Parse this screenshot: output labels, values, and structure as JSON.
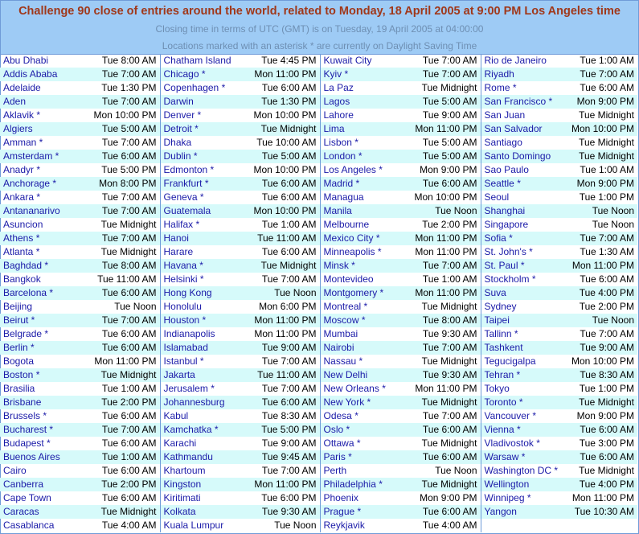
{
  "header": {
    "title": "Challenge 90 close of entries around the world, related to Monday, 18 April 2005 at 9:00 PM Los Angeles time",
    "utc_line": "Closing time in terms of UTC (GMT) is on Tuesday, 19 April 2005 at 04:00:00",
    "dst_line": "Locations marked with an asterisk * are currently on Daylight Saving Time"
  },
  "colors": {
    "header_bg": "#9ecbf5",
    "title_text": "#a0381a",
    "subtitle_text": "#6e8fb3",
    "city_link": "#1a1aa8",
    "row_stripe": "#d6fafa",
    "border": "#6f9bd8"
  },
  "rows": [
    [
      [
        "Abu Dhabi",
        "Tue 8:00 AM"
      ],
      [
        "Chatham Island",
        "Tue 4:45 PM"
      ],
      [
        "Kuwait City",
        "Tue 7:00 AM"
      ],
      [
        "Rio de Janeiro",
        "Tue 1:00 AM"
      ]
    ],
    [
      [
        "Addis Ababa",
        "Tue 7:00 AM"
      ],
      [
        "Chicago *",
        "Mon 11:00 PM"
      ],
      [
        "Kyiv *",
        "Tue 7:00 AM"
      ],
      [
        "Riyadh",
        "Tue 7:00 AM"
      ]
    ],
    [
      [
        "Adelaide",
        "Tue 1:30 PM"
      ],
      [
        "Copenhagen *",
        "Tue 6:00 AM"
      ],
      [
        "La Paz",
        "Tue Midnight"
      ],
      [
        "Rome *",
        "Tue 6:00 AM"
      ]
    ],
    [
      [
        "Aden",
        "Tue 7:00 AM"
      ],
      [
        "Darwin",
        "Tue 1:30 PM"
      ],
      [
        "Lagos",
        "Tue 5:00 AM"
      ],
      [
        "San Francisco *",
        "Mon 9:00 PM"
      ]
    ],
    [
      [
        "Aklavik *",
        "Mon 10:00 PM"
      ],
      [
        "Denver *",
        "Mon 10:00 PM"
      ],
      [
        "Lahore",
        "Tue 9:00 AM"
      ],
      [
        "San Juan",
        "Tue Midnight"
      ]
    ],
    [
      [
        "Algiers",
        "Tue 5:00 AM"
      ],
      [
        "Detroit *",
        "Tue Midnight"
      ],
      [
        "Lima",
        "Mon 11:00 PM"
      ],
      [
        "San Salvador",
        "Mon 10:00 PM"
      ]
    ],
    [
      [
        "Amman *",
        "Tue 7:00 AM"
      ],
      [
        "Dhaka",
        "Tue 10:00 AM"
      ],
      [
        "Lisbon *",
        "Tue 5:00 AM"
      ],
      [
        "Santiago",
        "Tue Midnight"
      ]
    ],
    [
      [
        "Amsterdam *",
        "Tue 6:00 AM"
      ],
      [
        "Dublin *",
        "Tue 5:00 AM"
      ],
      [
        "London *",
        "Tue 5:00 AM"
      ],
      [
        "Santo Domingo",
        "Tue Midnight"
      ]
    ],
    [
      [
        "Anadyr *",
        "Tue 5:00 PM"
      ],
      [
        "Edmonton *",
        "Mon 10:00 PM"
      ],
      [
        "Los Angeles *",
        "Mon 9:00 PM"
      ],
      [
        "Sao Paulo",
        "Tue 1:00 AM"
      ]
    ],
    [
      [
        "Anchorage *",
        "Mon 8:00 PM"
      ],
      [
        "Frankfurt *",
        "Tue 6:00 AM"
      ],
      [
        "Madrid *",
        "Tue 6:00 AM"
      ],
      [
        "Seattle *",
        "Mon 9:00 PM"
      ]
    ],
    [
      [
        "Ankara *",
        "Tue 7:00 AM"
      ],
      [
        "Geneva *",
        "Tue 6:00 AM"
      ],
      [
        "Managua",
        "Mon 10:00 PM"
      ],
      [
        "Seoul",
        "Tue 1:00 PM"
      ]
    ],
    [
      [
        "Antananarivo",
        "Tue 7:00 AM"
      ],
      [
        "Guatemala",
        "Mon 10:00 PM"
      ],
      [
        "Manila",
        "Tue Noon"
      ],
      [
        "Shanghai",
        "Tue Noon"
      ]
    ],
    [
      [
        "Asuncion",
        "Tue Midnight"
      ],
      [
        "Halifax *",
        "Tue 1:00 AM"
      ],
      [
        "Melbourne",
        "Tue 2:00 PM"
      ],
      [
        "Singapore",
        "Tue Noon"
      ]
    ],
    [
      [
        "Athens *",
        "Tue 7:00 AM"
      ],
      [
        "Hanoi",
        "Tue 11:00 AM"
      ],
      [
        "Mexico City *",
        "Mon 11:00 PM"
      ],
      [
        "Sofia *",
        "Tue 7:00 AM"
      ]
    ],
    [
      [
        "Atlanta *",
        "Tue Midnight"
      ],
      [
        "Harare",
        "Tue 6:00 AM"
      ],
      [
        "Minneapolis *",
        "Mon 11:00 PM"
      ],
      [
        "St. John's *",
        "Tue 1:30 AM"
      ]
    ],
    [
      [
        "Baghdad *",
        "Tue 8:00 AM"
      ],
      [
        "Havana *",
        "Tue Midnight"
      ],
      [
        "Minsk *",
        "Tue 7:00 AM"
      ],
      [
        "St. Paul *",
        "Mon 11:00 PM"
      ]
    ],
    [
      [
        "Bangkok",
        "Tue 11:00 AM"
      ],
      [
        "Helsinki *",
        "Tue 7:00 AM"
      ],
      [
        "Montevideo",
        "Tue 1:00 AM"
      ],
      [
        "Stockholm *",
        "Tue 6:00 AM"
      ]
    ],
    [
      [
        "Barcelona *",
        "Tue 6:00 AM"
      ],
      [
        "Hong Kong",
        "Tue Noon"
      ],
      [
        "Montgomery *",
        "Mon 11:00 PM"
      ],
      [
        "Suva",
        "Tue 4:00 PM"
      ]
    ],
    [
      [
        "Beijing",
        "Tue Noon"
      ],
      [
        "Honolulu",
        "Mon 6:00 PM"
      ],
      [
        "Montreal *",
        "Tue Midnight"
      ],
      [
        "Sydney",
        "Tue 2:00 PM"
      ]
    ],
    [
      [
        "Beirut *",
        "Tue 7:00 AM"
      ],
      [
        "Houston *",
        "Mon 11:00 PM"
      ],
      [
        "Moscow *",
        "Tue 8:00 AM"
      ],
      [
        "Taipei",
        "Tue Noon"
      ]
    ],
    [
      [
        "Belgrade *",
        "Tue 6:00 AM"
      ],
      [
        "Indianapolis",
        "Mon 11:00 PM"
      ],
      [
        "Mumbai",
        "Tue 9:30 AM"
      ],
      [
        "Tallinn *",
        "Tue 7:00 AM"
      ]
    ],
    [
      [
        "Berlin *",
        "Tue 6:00 AM"
      ],
      [
        "Islamabad",
        "Tue 9:00 AM"
      ],
      [
        "Nairobi",
        "Tue 7:00 AM"
      ],
      [
        "Tashkent",
        "Tue 9:00 AM"
      ]
    ],
    [
      [
        "Bogota",
        "Mon 11:00 PM"
      ],
      [
        "Istanbul *",
        "Tue 7:00 AM"
      ],
      [
        "Nassau *",
        "Tue Midnight"
      ],
      [
        "Tegucigalpa",
        "Mon 10:00 PM"
      ]
    ],
    [
      [
        "Boston *",
        "Tue Midnight"
      ],
      [
        "Jakarta",
        "Tue 11:00 AM"
      ],
      [
        "New Delhi",
        "Tue 9:30 AM"
      ],
      [
        "Tehran *",
        "Tue 8:30 AM"
      ]
    ],
    [
      [
        "Brasilia",
        "Tue 1:00 AM"
      ],
      [
        "Jerusalem *",
        "Tue 7:00 AM"
      ],
      [
        "New Orleans *",
        "Mon 11:00 PM"
      ],
      [
        "Tokyo",
        "Tue 1:00 PM"
      ]
    ],
    [
      [
        "Brisbane",
        "Tue 2:00 PM"
      ],
      [
        "Johannesburg",
        "Tue 6:00 AM"
      ],
      [
        "New York *",
        "Tue Midnight"
      ],
      [
        "Toronto *",
        "Tue Midnight"
      ]
    ],
    [
      [
        "Brussels *",
        "Tue 6:00 AM"
      ],
      [
        "Kabul",
        "Tue 8:30 AM"
      ],
      [
        "Odesa *",
        "Tue 7:00 AM"
      ],
      [
        "Vancouver *",
        "Mon 9:00 PM"
      ]
    ],
    [
      [
        "Bucharest *",
        "Tue 7:00 AM"
      ],
      [
        "Kamchatka *",
        "Tue 5:00 PM"
      ],
      [
        "Oslo *",
        "Tue 6:00 AM"
      ],
      [
        "Vienna *",
        "Tue 6:00 AM"
      ]
    ],
    [
      [
        "Budapest *",
        "Tue 6:00 AM"
      ],
      [
        "Karachi",
        "Tue 9:00 AM"
      ],
      [
        "Ottawa *",
        "Tue Midnight"
      ],
      [
        "Vladivostok *",
        "Tue 3:00 PM"
      ]
    ],
    [
      [
        "Buenos Aires",
        "Tue 1:00 AM"
      ],
      [
        "Kathmandu",
        "Tue 9:45 AM"
      ],
      [
        "Paris *",
        "Tue 6:00 AM"
      ],
      [
        "Warsaw *",
        "Tue 6:00 AM"
      ]
    ],
    [
      [
        "Cairo",
        "Tue 6:00 AM"
      ],
      [
        "Khartoum",
        "Tue 7:00 AM"
      ],
      [
        "Perth",
        "Tue Noon"
      ],
      [
        "Washington DC *",
        "Tue Midnight"
      ]
    ],
    [
      [
        "Canberra",
        "Tue 2:00 PM"
      ],
      [
        "Kingston",
        "Mon 11:00 PM"
      ],
      [
        "Philadelphia *",
        "Tue Midnight"
      ],
      [
        "Wellington",
        "Tue 4:00 PM"
      ]
    ],
    [
      [
        "Cape Town",
        "Tue 6:00 AM"
      ],
      [
        "Kiritimati",
        "Tue 6:00 PM"
      ],
      [
        "Phoenix",
        "Mon 9:00 PM"
      ],
      [
        "Winnipeg *",
        "Mon 11:00 PM"
      ]
    ],
    [
      [
        "Caracas",
        "Tue Midnight"
      ],
      [
        "Kolkata",
        "Tue 9:30 AM"
      ],
      [
        "Prague *",
        "Tue 6:00 AM"
      ],
      [
        "Yangon",
        "Tue 10:30 AM"
      ]
    ],
    [
      [
        "Casablanca",
        "Tue 4:00 AM"
      ],
      [
        "Kuala Lumpur",
        "Tue Noon"
      ],
      [
        "Reykjavik",
        "Tue 4:00 AM"
      ],
      [
        "",
        ""
      ]
    ]
  ]
}
